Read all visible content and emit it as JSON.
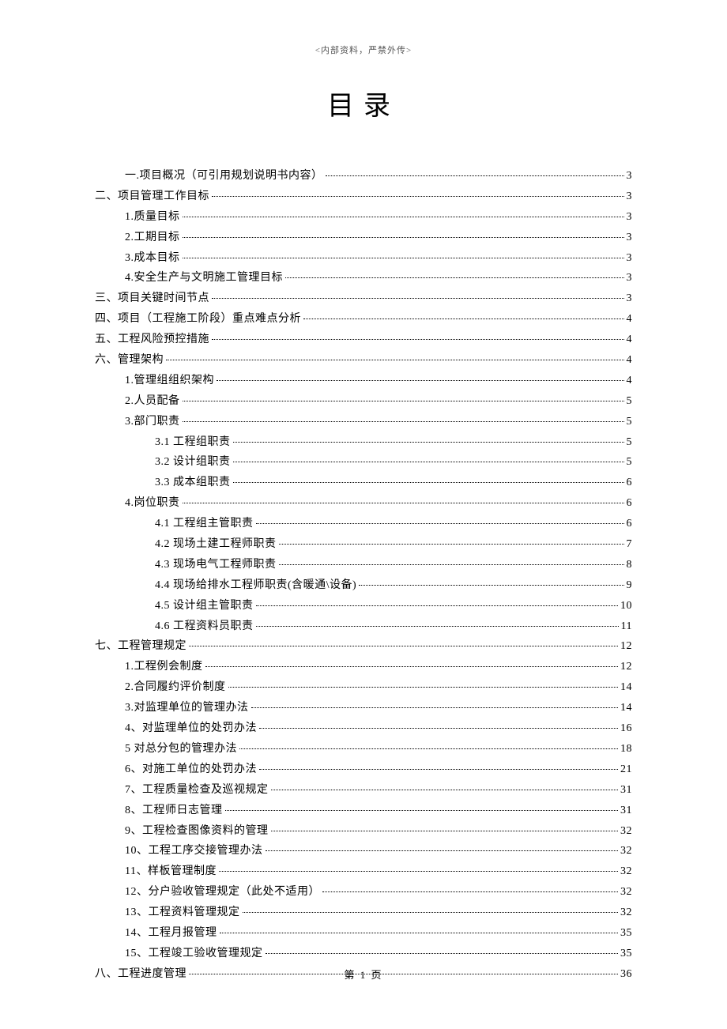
{
  "header_note": "<内部资料，严禁外传>",
  "title": "目录",
  "footer": "第 1 页",
  "toc": [
    {
      "label": "一.项目概况（可引用规划说明书内容）",
      "page": "3",
      "indent": 1
    },
    {
      "label": "二、项目管理工作目标",
      "page": "3",
      "indent": 0
    },
    {
      "label": "1.质量目标",
      "page": "3",
      "indent": 1
    },
    {
      "label": "2.工期目标",
      "page": "3",
      "indent": 1
    },
    {
      "label": "3.成本目标",
      "page": "3",
      "indent": 1
    },
    {
      "label": "4.安全生产与文明施工管理目标",
      "page": "3",
      "indent": 1
    },
    {
      "label": "三、项目关键时间节点",
      "page": "3",
      "indent": 0
    },
    {
      "label": "四、项目（工程施工阶段）重点难点分析",
      "page": "4",
      "indent": 0
    },
    {
      "label": "五、工程风险预控措施",
      "page": "4",
      "indent": 0
    },
    {
      "label": "六、管理架构",
      "page": "4",
      "indent": 0
    },
    {
      "label": "1.管理组组织架构",
      "page": "4",
      "indent": 1
    },
    {
      "label": "2.人员配备",
      "page": "5",
      "indent": 1
    },
    {
      "label": "3.部门职责",
      "page": "5",
      "indent": 1
    },
    {
      "label": "3.1 工程组职责 ",
      "page": "5",
      "indent": 2
    },
    {
      "label": "3.2 设计组职责 ",
      "page": "5",
      "indent": 2
    },
    {
      "label": "3.3 成本组职责 ",
      "page": "6",
      "indent": 2
    },
    {
      "label": "4.岗位职责",
      "page": "6",
      "indent": 1
    },
    {
      "label": "4.1 工程组主管职责 ",
      "page": "6",
      "indent": 2
    },
    {
      "label": "4.2 现场土建工程师职责 ",
      "page": "7",
      "indent": 2
    },
    {
      "label": "4.3 现场电气工程师职责 ",
      "page": "8",
      "indent": 2
    },
    {
      "label": "4.4 现场给排水工程师职责(含暖通\\设备) ",
      "page": "9",
      "indent": 2
    },
    {
      "label": "4.5 设计组主管职责 ",
      "page": "10",
      "indent": 2
    },
    {
      "label": "4.6 工程资料员职责 ",
      "page": "11",
      "indent": 2
    },
    {
      "label": "七、工程管理规定",
      "page": "12",
      "indent": 0
    },
    {
      "label": "1.工程例会制度",
      "page": "12",
      "indent": 1
    },
    {
      "label": "2.合同履约评价制度",
      "page": "14",
      "indent": 1
    },
    {
      "label": "3.对监理单位的管理办法",
      "page": "14",
      "indent": 1
    },
    {
      "label": "4、对监理单位的处罚办法",
      "page": "16",
      "indent": 1
    },
    {
      "label": "5 对总分包的管理办法 ",
      "page": " 18",
      "indent": 1
    },
    {
      "label": "6、对施工单位的处罚办法",
      "page": "21",
      "indent": 1
    },
    {
      "label": "7、工程质量检查及巡视规定",
      "page": "31",
      "indent": 1
    },
    {
      "label": "8、工程师日志管理",
      "page": "31",
      "indent": 1
    },
    {
      "label": "9、工程检查图像资料的管理",
      "page": "32",
      "indent": 1
    },
    {
      "label": "10、工程工序交接管理办法",
      "page": "32",
      "indent": 1
    },
    {
      "label": "11、样板管理制度",
      "page": "32",
      "indent": 1
    },
    {
      "label": "12、分户验收管理规定（此处不适用）",
      "page": "32",
      "indent": 1
    },
    {
      "label": "13、工程资料管理规定",
      "page": "32",
      "indent": 1
    },
    {
      "label": "14、工程月报管理",
      "page": "35",
      "indent": 1
    },
    {
      "label": "15、工程竣工验收管理规定",
      "page": "35",
      "indent": 1
    },
    {
      "label": "八、工程进度管理",
      "page": "36",
      "indent": 0
    }
  ]
}
